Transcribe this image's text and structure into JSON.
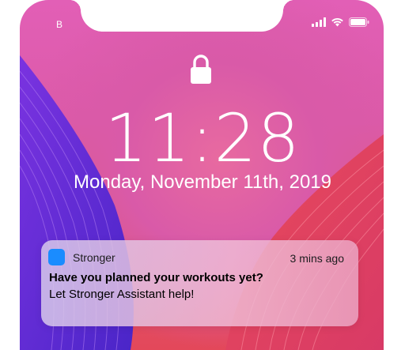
{
  "status_bar": {
    "carrier": "B",
    "icons": [
      "cellular-signal-icon",
      "wifi-icon",
      "battery-icon"
    ]
  },
  "lock_screen": {
    "lock_icon": "padlock-icon",
    "time": "11:28",
    "date": "Monday, November 11th, 2019"
  },
  "notification": {
    "app_name": "Stronger",
    "app_icon_color": "#1a8cff",
    "time_ago": "3 mins ago",
    "title": "Have you planned your workouts yet?",
    "body": "Let Stronger Assistant help!"
  },
  "colors": {
    "wallpaper_pink": "#e25fb6",
    "wallpaper_purple": "#5a2bd6",
    "wallpaper_red": "#e3485a"
  }
}
